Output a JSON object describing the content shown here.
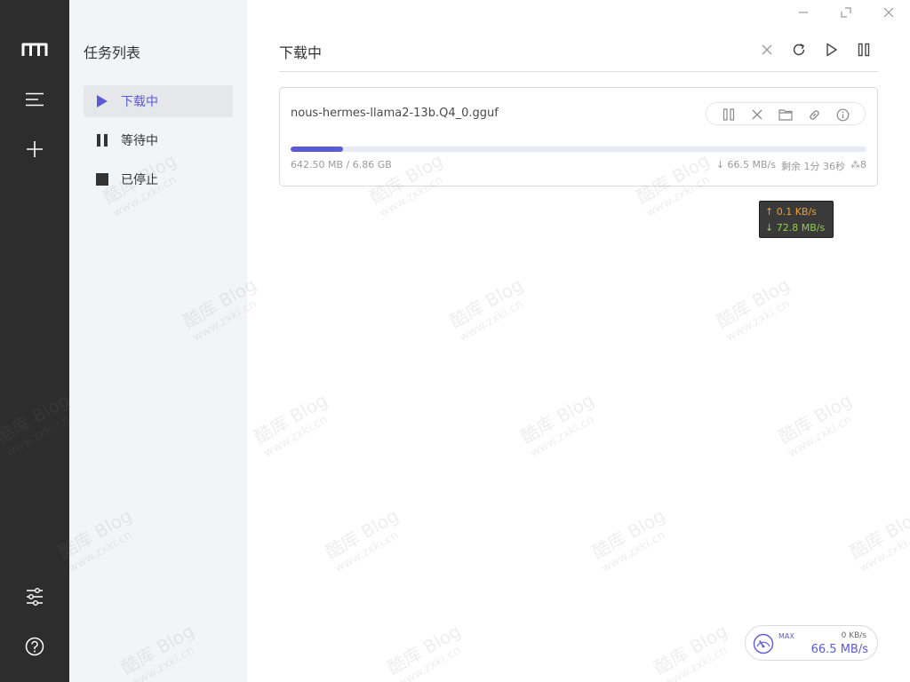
{
  "rail": {
    "logo_icon": "motrix-logo-icon",
    "menu_icon": "menu-lines-icon",
    "add_icon": "plus-icon",
    "settings_icon": "sliders-icon",
    "help_icon": "help-circle-icon"
  },
  "sidebar": {
    "title": "任务列表",
    "items": [
      {
        "label": "下载中",
        "icon": "play-icon",
        "active": true
      },
      {
        "label": "等待中",
        "icon": "pause-icon",
        "active": false
      },
      {
        "label": "已停止",
        "icon": "stop-icon",
        "active": false
      }
    ]
  },
  "window_controls": [
    "minimize-icon",
    "maximize-icon",
    "close-icon"
  ],
  "main": {
    "title": "下载中",
    "toolbar_icons": [
      "close-icon",
      "refresh-icon",
      "play-icon",
      "pause-icon"
    ]
  },
  "task": {
    "name": "nous-hermes-llama2-13b.Q4_0.gguf",
    "progress_fraction": 0.091,
    "size": "642.50 MB / 6.86 GB",
    "speed": "↓ 66.5 MB/s",
    "remaining": "剩余 1分 36秒",
    "connections": "⁂8",
    "action_icons": [
      "pause-icon",
      "close-icon",
      "folder-icon",
      "link-icon",
      "info-icon"
    ]
  },
  "tooltip": {
    "upload": "↑ 0.1 KB/s",
    "download": "↓ 72.8 MB/s"
  },
  "speedometer": {
    "max_label": "MAX",
    "upload": "0 KB/s",
    "download": "66.5 MB/s"
  },
  "watermark": {
    "brand": "酷库 Blog",
    "url": "www.zxki.cn"
  },
  "colors": {
    "accent": "#5b5bd6",
    "rail_bg": "#2d2d2d",
    "sidebar_bg": "#f3f4f6"
  }
}
